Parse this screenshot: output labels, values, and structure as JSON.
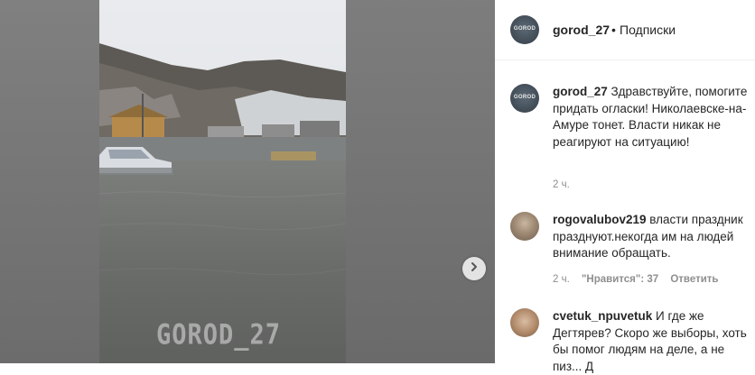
{
  "post": {
    "watermark": "GOROD_27",
    "account": "gorod_27",
    "separator": "•",
    "follow_label": "Подписки",
    "avatar_text": "GOROD"
  },
  "comments": [
    {
      "username": "gorod_27",
      "text": " Здравствуйте, помогите придать огласки! Николаевске-на-Амуре тонет. Власти никак не реагируют на ситуацию!",
      "time": "2 ч.",
      "likes": "",
      "reply": ""
    },
    {
      "username": "rogovalubov219",
      "text": " власти праздник празднуют.некогда им на людей внимание обращать.",
      "time": "2 ч.",
      "likes": "\"Нравится\": 37",
      "reply": "Ответить"
    },
    {
      "username": "cvetuk_npuvetuk",
      "text": " И где же Дегтярев? Скоро же выборы, хоть бы помог людям на деле, а не пиз... Д",
      "time": "",
      "likes": "",
      "reply": ""
    }
  ],
  "icons": {
    "next": "chevron-right-icon"
  }
}
